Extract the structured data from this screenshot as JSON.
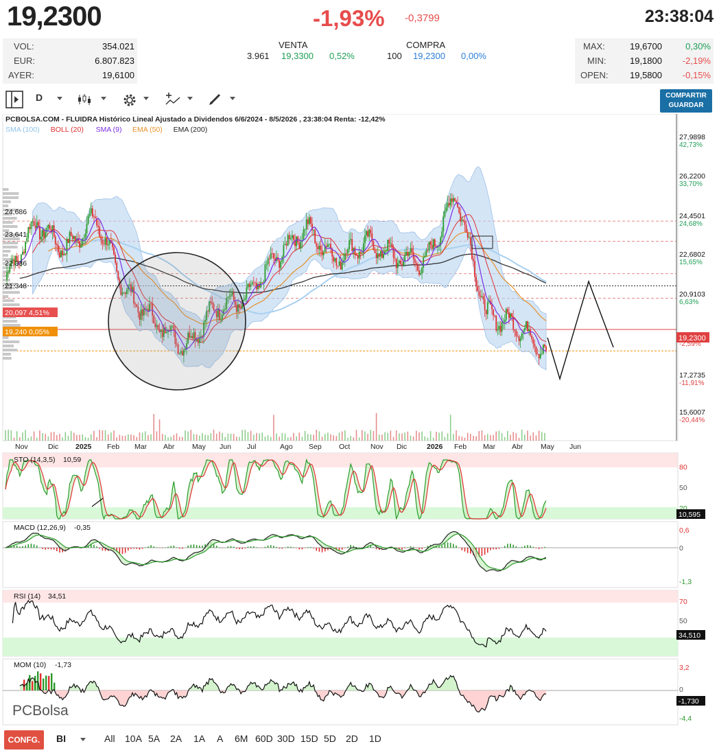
{
  "quote": {
    "price": "19,2300",
    "change_pct": "-1,93%",
    "change_abs": "-0,3799",
    "time": "23:38:04",
    "left_stats": [
      {
        "label": "VOL:",
        "value": "354.021"
      },
      {
        "label": "EUR:",
        "value": "6.807.823"
      },
      {
        "label": "AYER:",
        "value": "19,6100"
      }
    ],
    "venta": {
      "header": "VENTA",
      "qty": "3.961",
      "price": "19,3300",
      "pct": "0,52%"
    },
    "compra": {
      "header": "COMPRA",
      "qty": "100",
      "price": "19,2300",
      "pct": "0,00%"
    },
    "right_stats": [
      {
        "label": "MAX:",
        "value": "19,6700",
        "pct": "0,30%",
        "color": "green"
      },
      {
        "label": "MIN:",
        "value": "19,1800",
        "pct": "-2,19%",
        "color": "red"
      },
      {
        "label": "OPEN:",
        "value": "19,5800",
        "pct": "-0,15%",
        "color": "red"
      }
    ]
  },
  "toolbar": {
    "period": "D",
    "share_line1": "COMPARTIR",
    "share_line2": "GUARDAR"
  },
  "main_chart": {
    "title": "PCBOLSA.COM - FLUIDRA Histórico Lineal Ajustado a Dividendos 6/6/2024 - 8/5/2026 , 23:38:04 Renta: -12,42%",
    "legend": [
      {
        "name": "SMA (100)",
        "color": "#8fc3ea"
      },
      {
        "name": "BOLL (20)",
        "color": "#e03030"
      },
      {
        "name": "SMA (9)",
        "color": "#7b2fe0"
      },
      {
        "name": "EMA (50)",
        "color": "#e8902a"
      },
      {
        "name": "EMA (200)",
        "color": "#222222"
      }
    ],
    "right_axis": [
      {
        "price": "27,9898",
        "pct": "42,73%",
        "pct_color": "green"
      },
      {
        "price": "26,2200",
        "pct": "33,70%",
        "pct_color": "green"
      },
      {
        "price": "24,4501",
        "pct": "24,68%",
        "pct_color": "green"
      },
      {
        "price": "22,6802",
        "pct": "15,65%",
        "pct_color": "green"
      },
      {
        "price": "20,9103",
        "pct": "6,63%",
        "pct_color": "green"
      },
      {
        "price": "17,2735",
        "pct": "-11,91%",
        "pct_color": "red"
      },
      {
        "price": "15,6007",
        "pct": "-20,44%",
        "pct_color": "red"
      }
    ],
    "left_levels": [
      {
        "value": "24,686"
      },
      {
        "value": "23,641"
      },
      {
        "value": "22,336"
      },
      {
        "value": "21,348"
      }
    ],
    "tag_red": "20,097  4,51%",
    "tag_orange": "19,240  0,05%",
    "tag_current": "19,2300",
    "hidden_pct": "-2,59%",
    "x_labels": [
      "Nov",
      "Dic",
      "2025",
      "Feb",
      "Mar",
      "Abr",
      "May",
      "Jun",
      "Jul",
      "Ago",
      "Sep",
      "Oct",
      "Nov",
      "Dic",
      "2026",
      "Feb",
      "Mar",
      "Abr",
      "May",
      "Jun"
    ]
  },
  "indicators": {
    "sto": {
      "label": "STO (14,3,5)",
      "value": "10,59",
      "levels": [
        "80",
        "50",
        "20"
      ],
      "tag": "10,595"
    },
    "macd": {
      "label": "MACD (12,26,9)",
      "value": "-0,35",
      "levels": [
        "0,6",
        "0",
        "-1,3"
      ]
    },
    "rsi": {
      "label": "RSI (14)",
      "value": "34,51",
      "levels": [
        "70",
        "50"
      ],
      "tag": "34,510"
    },
    "mom": {
      "label": "MOM (10)",
      "value": "-1,73",
      "levels": [
        "3,2",
        "0",
        "-4,4"
      ],
      "tag": "-1,730"
    }
  },
  "watermark": "PCBolsa",
  "bottom_bar": {
    "config": "CONFG.",
    "mode": "BI",
    "ranges": [
      "All",
      "10A",
      "5A",
      "2A",
      "1A",
      "A",
      "6M",
      "60D",
      "30D",
      "15D",
      "5D",
      "2D",
      "1D"
    ]
  },
  "chart_data": {
    "type": "line",
    "title": "PCBOLSA.COM - FLUIDRA Histórico Lineal Ajustado a Dividendos 6/6/2024 - 8/5/2026 , 23:38:04 Renta: -12,42%",
    "xlabel": "",
    "ylabel": "",
    "ylim": [
      15.6,
      28.0
    ],
    "x": [
      "Nov",
      "Dic",
      "2025",
      "Feb",
      "Mar",
      "Abr",
      "May",
      "Jun",
      "Jul",
      "Ago",
      "Sep",
      "Oct",
      "Nov",
      "Dic",
      "2026",
      "Feb",
      "Mar",
      "Abr",
      "May"
    ],
    "series": [
      {
        "name": "",
        "values": [
          22.1,
          24.4,
          23.3,
          24.6,
          21.6,
          20.4,
          19.4,
          21.0,
          21.3,
          23.0,
          24.2,
          22.9,
          23.6,
          23.0,
          22.8,
          25.6,
          20.7,
          20.3,
          19.23
        ]
      }
    ],
    "grid": false,
    "legend": "top-left"
  }
}
